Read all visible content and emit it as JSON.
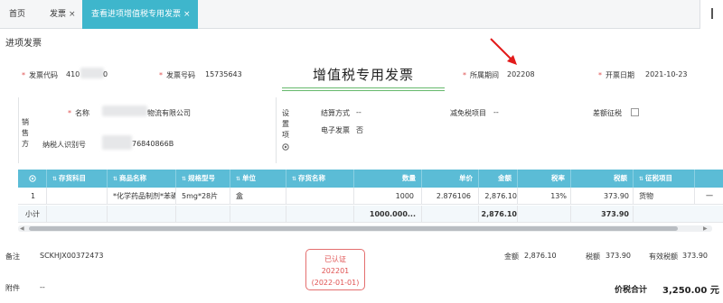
{
  "tabs": [
    {
      "label": "首页",
      "closable": false,
      "active": false
    },
    {
      "label": "发票",
      "closable": true,
      "active": false
    },
    {
      "label": "查看进项增值税专用发票",
      "closable": true,
      "active": true
    }
  ],
  "close_glyph": "×",
  "page_title": "进项发票",
  "header": {
    "invoice_code_label": "发票代码",
    "invoice_code_value": "410",
    "invoice_code_value_tail": "0",
    "invoice_number_label": "发票号码",
    "invoice_number_value": "15735643",
    "invoice_title": "增值税专用发票",
    "period_label": "所属期间",
    "period_value": "202208",
    "issue_date_label": "开票日期",
    "issue_date_value": "2021-10-23"
  },
  "seller": {
    "section_label": "销售方",
    "name_label": "名称",
    "name_value_tail": "物流有限公司",
    "taxid_label": "纳税人识别号",
    "taxid_value_tail": "76840866B"
  },
  "settings": {
    "section_label": "设置项",
    "icon": "gear-icon",
    "settlement_label": "结算方式",
    "settlement_value": "--",
    "tax_reduction_label": "减免税项目",
    "tax_reduction_value": "--",
    "diff_tax_label": "差额征税",
    "e_invoice_label": "电子发票",
    "e_invoice_value": "否"
  },
  "table": {
    "gear_icon": "gear-icon",
    "sort_glyph": "⇅",
    "columns": [
      "存货科目",
      "商品名称",
      "规格型号",
      "单位",
      "存货名称",
      "数量",
      "单价",
      "金额",
      "税率",
      "税额",
      "征税项目"
    ],
    "rows": [
      {
        "index": "1",
        "account": "",
        "product": "*化学药品制剂*苯磺",
        "spec": "5mg*28片",
        "unit": "盒",
        "inventory": "",
        "qty": "1000",
        "price": "2.876106",
        "amount": "2,876.10",
        "tax_rate": "13%",
        "tax": "373.90",
        "tax_item": "货物",
        "extra": "一"
      }
    ],
    "subtotal": {
      "label": "小计",
      "qty": "1000.000...",
      "amount": "2,876.10",
      "tax": "373.90"
    }
  },
  "footer": {
    "remark_label": "备注",
    "remark_value": "SCKHJX00372473",
    "attachment_label": "附件",
    "attachment_value": "--",
    "amount_label": "金额",
    "amount_value": "2,876.10",
    "tax_label": "税额",
    "tax_value": "373.90",
    "effective_tax_label": "有效税额",
    "effective_tax_value": "373.90",
    "total_label": "价税合计",
    "total_value": "3,250.00 元"
  },
  "stamp": {
    "line1": "已认证",
    "line2": "202201",
    "line3": "(2022-01-01)"
  },
  "colors": {
    "tab_active": "#3eb6cc",
    "table_header": "#5bbcd6",
    "stamp": "#e05252",
    "required": "#e05252",
    "arrow": "#e21b1b",
    "title_underline": "#66b96c"
  }
}
